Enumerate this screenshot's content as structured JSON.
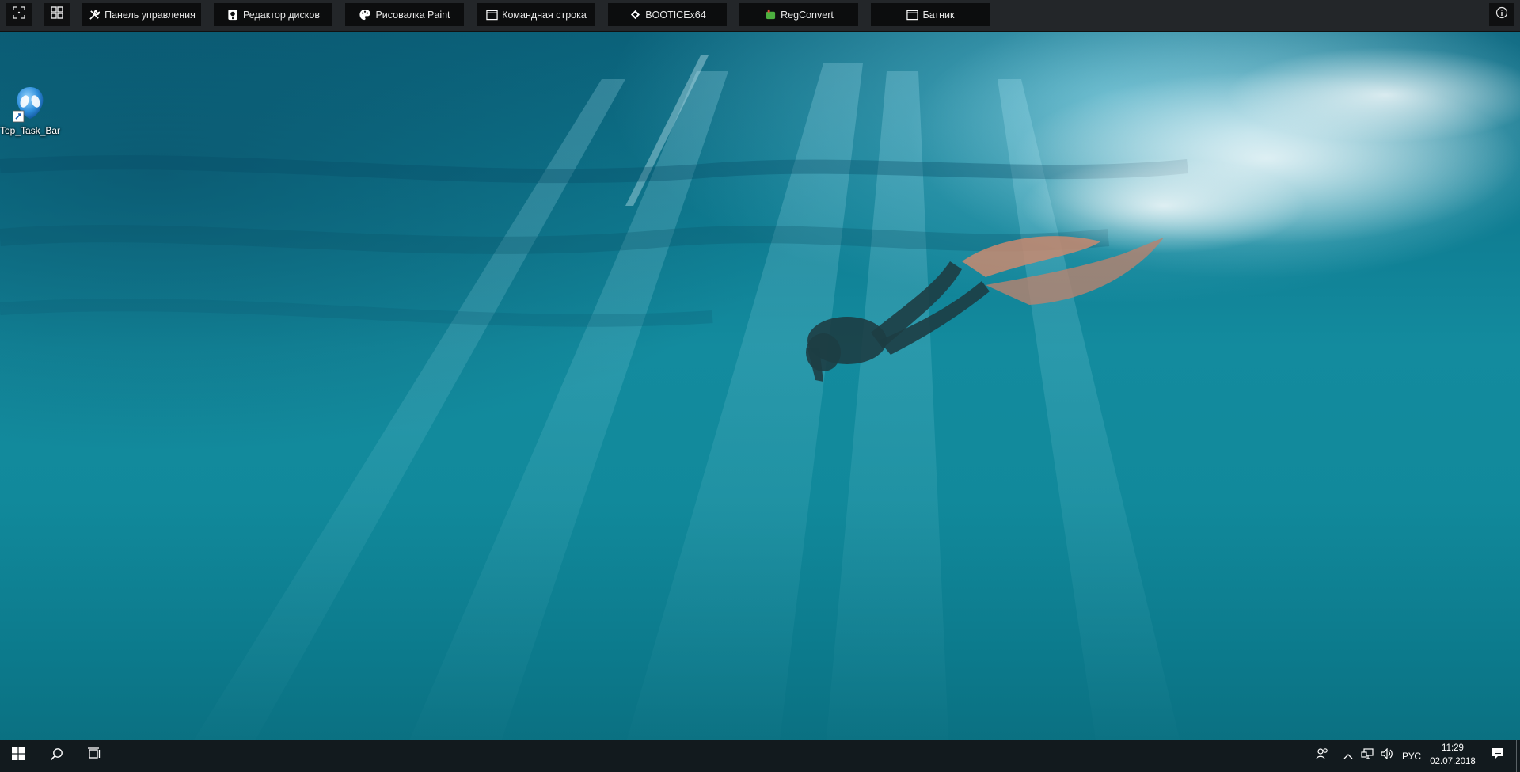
{
  "top_bar": {
    "buttons": [
      {
        "label": "Панель управления",
        "icon": "tools-icon"
      },
      {
        "label": "Редактор дисков",
        "icon": "disk-editor-icon"
      },
      {
        "label": "Рисовалка Paint",
        "icon": "paint-palette-icon"
      },
      {
        "label": "Командная строка",
        "icon": "window-icon"
      },
      {
        "label": "BOOTICEx64",
        "icon": "diamond-icon"
      },
      {
        "label": "RegConvert",
        "icon": "regconvert-icon"
      },
      {
        "label": "Батник",
        "icon": "window-icon"
      }
    ],
    "left_icons": [
      "screenshot-icon",
      "tile-grid-icon"
    ],
    "right_icon": "info-icon"
  },
  "desktop": {
    "icons": [
      {
        "label": "Top_Task_Bar",
        "icon": "alien-shortcut-icon"
      }
    ]
  },
  "taskbar": {
    "language": "РУС",
    "time": "11:29",
    "date": "02.07.2018",
    "colors": {
      "background": "#121a1e",
      "text": "#ffffff"
    }
  }
}
